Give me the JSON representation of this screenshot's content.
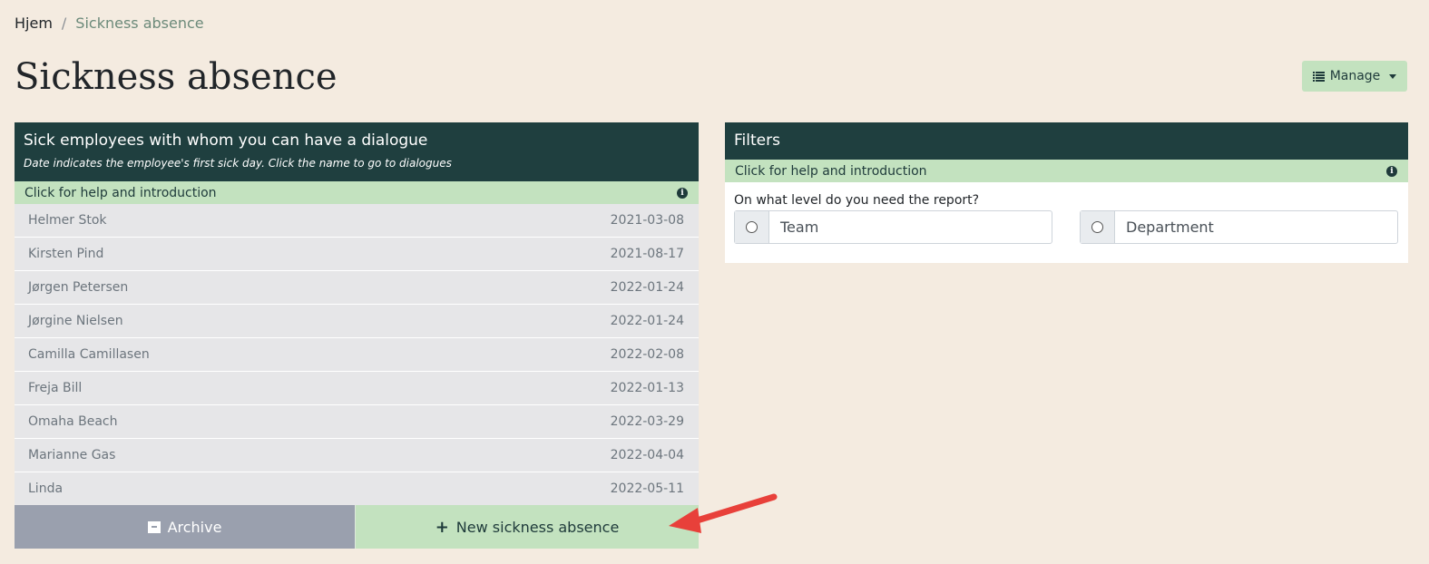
{
  "breadcrumb": {
    "home": "Hjem",
    "separator": "/",
    "current": "Sickness absence"
  },
  "page": {
    "title": "Sickness absence"
  },
  "manage": {
    "label": "Manage",
    "icon": "list-icon"
  },
  "left_panel": {
    "title": "Sick employees with whom you can have a dialogue",
    "subtitle": "Date indicates the employee's first sick day. Click the name to go to dialogues",
    "help": "Click for help and introduction",
    "employees": [
      {
        "name": "Helmer Stok",
        "date": "2021-03-08"
      },
      {
        "name": "Kirsten Pind",
        "date": "2021-08-17"
      },
      {
        "name": "Jørgen Petersen",
        "date": "2022-01-24"
      },
      {
        "name": "Jørgine Nielsen",
        "date": "2022-01-24"
      },
      {
        "name": "Camilla Camillasen",
        "date": "2022-02-08"
      },
      {
        "name": "Freja Bill",
        "date": "2022-01-13"
      },
      {
        "name": "Omaha Beach",
        "date": "2022-03-29"
      },
      {
        "name": "Marianne Gas",
        "date": "2022-04-04"
      },
      {
        "name": "Linda",
        "date": "2022-05-11"
      }
    ],
    "archive_label": "Archive",
    "new_label": "New sickness absence"
  },
  "filters": {
    "title": "Filters",
    "help": "Click for help and introduction",
    "question": "On what level do you need the report?",
    "options": [
      "Team",
      "Department"
    ]
  },
  "colors": {
    "dark_header": "#1f3f3f",
    "light_green": "#c3e2bf",
    "background": "#f4ebe0",
    "annotation_arrow": "#e8403a"
  }
}
